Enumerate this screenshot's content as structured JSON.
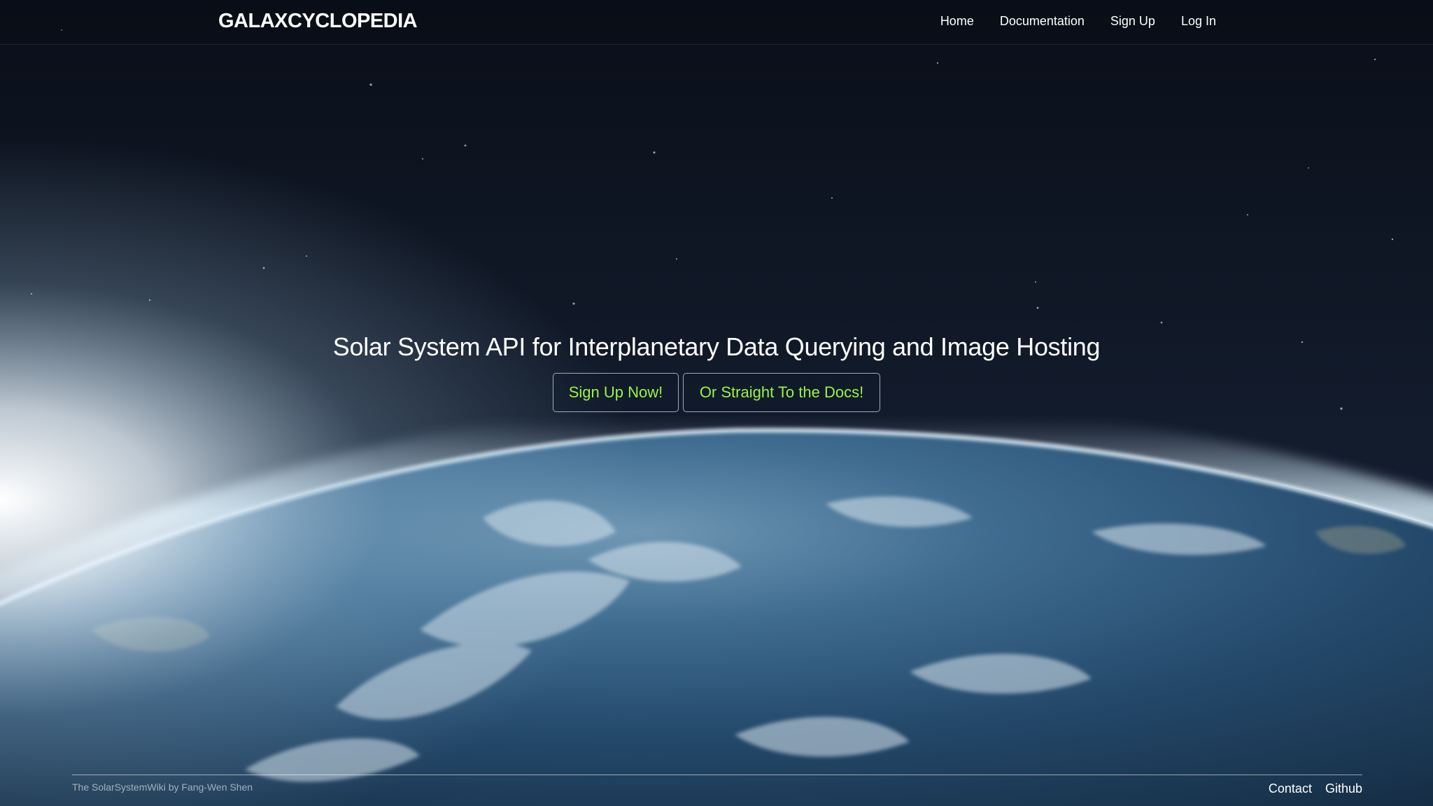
{
  "brand": {
    "name": "GALAXCYCLOPEDIA"
  },
  "nav": {
    "items": [
      {
        "label": "Home"
      },
      {
        "label": "Documentation"
      },
      {
        "label": "Sign Up"
      },
      {
        "label": "Log In"
      }
    ]
  },
  "hero": {
    "title": "Solar System API for Interplanetary Data Querying and Image Hosting",
    "primary_button": "Sign Up Now!",
    "secondary_button": "Or Straight To the Docs!"
  },
  "footer": {
    "credit": "The SolarSystemWiki by Fang-Wen Shen",
    "links": [
      {
        "label": "Contact"
      },
      {
        "label": "Github"
      }
    ]
  },
  "colors": {
    "button_text": "#9cf24a",
    "text": "#ffffff",
    "space": "#0b111c",
    "ocean": "#1b3550"
  },
  "background": {
    "icon": "earth-from-orbit-image"
  }
}
